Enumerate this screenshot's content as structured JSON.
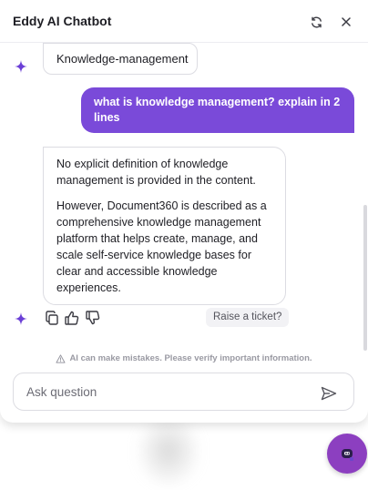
{
  "header": {
    "title": "Eddy AI Chatbot",
    "refresh_icon": "refresh-icon",
    "close_icon": "close-icon"
  },
  "conversation": {
    "context_chip": "Knowledge-management",
    "user_message": "what is knowledge management? explain in 2 lines",
    "bot_message": [
      "No explicit definition of knowledge management is provided in the content.",
      "However, Document360 is described as a comprehensive knowledge management platform that helps create, manage, and scale self-service knowledge bases for clear and accessible knowledge experiences."
    ],
    "actions": {
      "copy_icon": "copy-icon",
      "like_icon": "thumbs-up-icon",
      "dislike_icon": "thumbs-down-icon",
      "ticket_label": "Raise a ticket?"
    }
  },
  "disclaimer": "AI can make mistakes. Please verify important information.",
  "composer": {
    "placeholder": "Ask question",
    "value": "",
    "send_icon": "send-icon"
  },
  "colors": {
    "accent": "#7a4ad9",
    "sparkle": "#6b3fd6",
    "fab": "#8c3fc0"
  }
}
